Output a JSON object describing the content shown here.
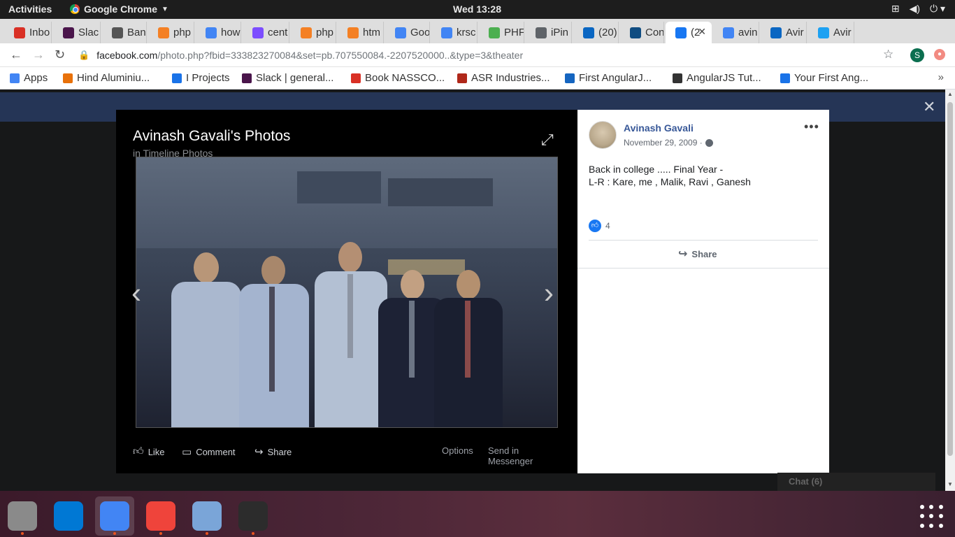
{
  "topbar": {
    "activities": "Activities",
    "app_name": "Google Chrome",
    "clock": "Wed 13:28",
    "tray_icons": [
      "network-icon",
      "volume-icon",
      "power-icon"
    ]
  },
  "tabs": [
    {
      "label": "Inbo",
      "icon": "gmail-icon",
      "color": "#d93025"
    },
    {
      "label": "Slac",
      "icon": "slack-icon",
      "color": "#4a154b"
    },
    {
      "label": "Ban",
      "icon": "page-icon",
      "color": "#555555"
    },
    {
      "label": "php",
      "icon": "stackoverflow-icon",
      "color": "#f48024"
    },
    {
      "label": "how",
      "icon": "google-icon",
      "color": "#4285f4"
    },
    {
      "label": "cent",
      "icon": "page-icon",
      "color": "#7c4dff"
    },
    {
      "label": "php",
      "icon": "stackoverflow-icon",
      "color": "#f48024"
    },
    {
      "label": "htm",
      "icon": "stackoverflow-icon",
      "color": "#f48024"
    },
    {
      "label": "Goo",
      "icon": "chrome-icon",
      "color": "#4285f4"
    },
    {
      "label": "krsc",
      "icon": "google-icon",
      "color": "#4285f4"
    },
    {
      "label": "PHF",
      "icon": "w3schools-icon",
      "color": "#4caf50"
    },
    {
      "label": "iPin",
      "icon": "page-icon",
      "color": "#5f6368"
    },
    {
      "label": "(20)",
      "icon": "linkedin-icon",
      "color": "#0a66c2"
    },
    {
      "label": "Con",
      "icon": "edge-icon",
      "color": "#0f4c81"
    },
    {
      "label": "(2",
      "icon": "facebook-icon",
      "color": "#1877f2",
      "active": true
    },
    {
      "label": "avin",
      "icon": "google-icon",
      "color": "#4285f4"
    },
    {
      "label": "Avir",
      "icon": "linkedin-icon",
      "color": "#0a66c2"
    },
    {
      "label": "Avir",
      "icon": "twitter-icon",
      "color": "#1da1f2"
    }
  ],
  "toolbar": {
    "url_host": "facebook.com",
    "url_rest": "/photo.php?fbid=333823270084&set=pb.707550084.-2207520000..&type=3&theater",
    "profile_initial": "S"
  },
  "bookmarks": [
    {
      "label": "Apps",
      "icon": "apps-grid-icon",
      "color": "#4285f4"
    },
    {
      "label": "Hind Aluminiu...",
      "icon": "page-icon",
      "color": "#e8710a"
    },
    {
      "label": "I Projects",
      "icon": "page-icon",
      "color": "#1a73e8"
    },
    {
      "label": "Slack | general...",
      "icon": "slack-icon",
      "color": "#4a154b"
    },
    {
      "label": "Book NASSCO...",
      "icon": "page-icon",
      "color": "#d93025"
    },
    {
      "label": "ASR Industries...",
      "icon": "page-icon",
      "color": "#b0281a"
    },
    {
      "label": "First AngularJ...",
      "icon": "page-icon",
      "color": "#1565c0"
    },
    {
      "label": "AngularJS Tut...",
      "icon": "page-icon",
      "color": "#333333"
    },
    {
      "label": "Your First Ang...",
      "icon": "page-icon",
      "color": "#1a73e8"
    }
  ],
  "bookmarks_more": "»",
  "photo_viewer": {
    "title": "Avinash Gavali's Photos",
    "subtitle": "in Timeline Photos",
    "actions": {
      "like": "Like",
      "comment": "Comment",
      "share": "Share",
      "options": "Options",
      "send": "Send in Messenger"
    }
  },
  "post": {
    "author": "Avinash Gavali",
    "date": "November 29, 2009 ·",
    "caption_line1": "Back in college ..... Final Year -",
    "caption_line2": "L-R : Kare, me , Malik, Ravi , Ganesh",
    "like_count": "4",
    "share_label": "Share"
  },
  "chat": {
    "label": "Chat (6)"
  },
  "dock": [
    {
      "name": "files-app",
      "color": "#8a8a8a"
    },
    {
      "name": "vscode-app",
      "color": "#0078d4"
    },
    {
      "name": "chrome-app",
      "color": "#4285f4",
      "active": true
    },
    {
      "name": "anydesk-app",
      "color": "#ef443b"
    },
    {
      "name": "virtualbox-app",
      "color": "#7aa5d8"
    },
    {
      "name": "terminal-app",
      "color": "#2c2c2c"
    }
  ]
}
